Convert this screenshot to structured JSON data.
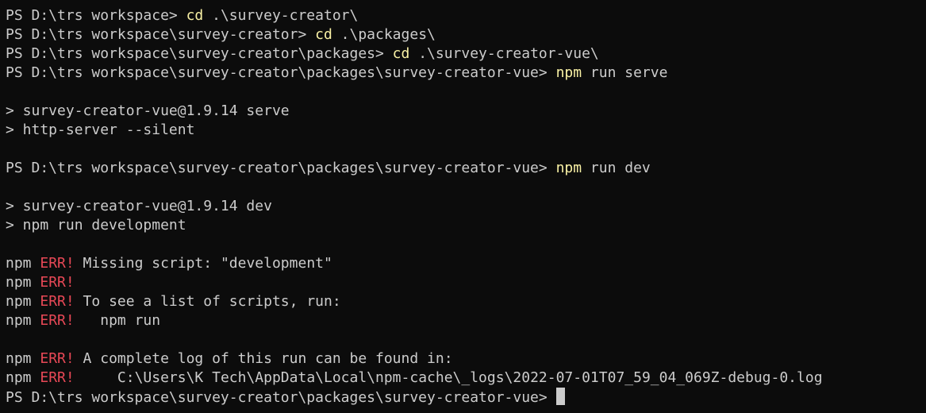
{
  "terminal": {
    "colors": {
      "background": "#0c0c0c",
      "foreground": "#cccccc",
      "command": "#f9f1a5",
      "error": "#e74856"
    },
    "lines": [
      {
        "segments": [
          {
            "text": "PS D:\\trs workspace> ",
            "style": "normal"
          },
          {
            "text": "cd",
            "style": "cmd"
          },
          {
            "text": " .\\survey-creator\\",
            "style": "normal"
          }
        ]
      },
      {
        "segments": [
          {
            "text": "PS D:\\trs workspace\\survey-creator> ",
            "style": "normal"
          },
          {
            "text": "cd",
            "style": "cmd"
          },
          {
            "text": " .\\packages\\",
            "style": "normal"
          }
        ]
      },
      {
        "segments": [
          {
            "text": "PS D:\\trs workspace\\survey-creator\\packages> ",
            "style": "normal"
          },
          {
            "text": "cd",
            "style": "cmd"
          },
          {
            "text": " .\\survey-creator-vue\\",
            "style": "normal"
          }
        ]
      },
      {
        "segments": [
          {
            "text": "PS D:\\trs workspace\\survey-creator\\packages\\survey-creator-vue> ",
            "style": "normal"
          },
          {
            "text": "npm",
            "style": "cmd"
          },
          {
            "text": " run serve",
            "style": "normal"
          }
        ]
      },
      {
        "segments": []
      },
      {
        "segments": [
          {
            "text": "> survey-creator-vue@1.9.14 serve",
            "style": "normal"
          }
        ]
      },
      {
        "segments": [
          {
            "text": "> http-server --silent",
            "style": "normal"
          }
        ]
      },
      {
        "segments": []
      },
      {
        "segments": [
          {
            "text": "PS D:\\trs workspace\\survey-creator\\packages\\survey-creator-vue> ",
            "style": "normal"
          },
          {
            "text": "npm",
            "style": "cmd"
          },
          {
            "text": " run dev",
            "style": "normal"
          }
        ]
      },
      {
        "segments": []
      },
      {
        "segments": [
          {
            "text": "> survey-creator-vue@1.9.14 dev",
            "style": "normal"
          }
        ]
      },
      {
        "segments": [
          {
            "text": "> npm run development",
            "style": "normal"
          }
        ]
      },
      {
        "segments": []
      },
      {
        "segments": [
          {
            "text": "npm ",
            "style": "normal"
          },
          {
            "text": "ERR!",
            "style": "err"
          },
          {
            "text": " Missing script: \"development\"",
            "style": "normal"
          }
        ]
      },
      {
        "segments": [
          {
            "text": "npm ",
            "style": "normal"
          },
          {
            "text": "ERR!",
            "style": "err"
          }
        ]
      },
      {
        "segments": [
          {
            "text": "npm ",
            "style": "normal"
          },
          {
            "text": "ERR!",
            "style": "err"
          },
          {
            "text": " To see a list of scripts, run:",
            "style": "normal"
          }
        ]
      },
      {
        "segments": [
          {
            "text": "npm ",
            "style": "normal"
          },
          {
            "text": "ERR!",
            "style": "err"
          },
          {
            "text": "   npm run",
            "style": "normal"
          }
        ]
      },
      {
        "segments": []
      },
      {
        "segments": [
          {
            "text": "npm ",
            "style": "normal"
          },
          {
            "text": "ERR!",
            "style": "err"
          },
          {
            "text": " A complete log of this run can be found in:",
            "style": "normal"
          }
        ]
      },
      {
        "segments": [
          {
            "text": "npm ",
            "style": "normal"
          },
          {
            "text": "ERR!",
            "style": "err"
          },
          {
            "text": "     C:\\Users\\K Tech\\AppData\\Local\\npm-cache\\_logs\\2022-07-01T07_59_04_069Z-debug-0.log",
            "style": "normal"
          }
        ]
      },
      {
        "segments": [
          {
            "text": "PS D:\\trs workspace\\survey-creator\\packages\\survey-creator-vue> ",
            "style": "normal"
          }
        ],
        "cursor": true
      }
    ]
  }
}
